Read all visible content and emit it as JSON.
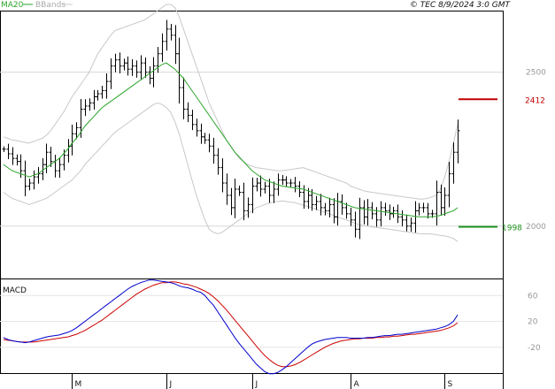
{
  "legend": {
    "ma_label": "MA20",
    "bands_label": "BBands"
  },
  "header": {
    "copyright": "© TEC 8/9/2024 3:0 GMT"
  },
  "macd": {
    "label": "MACD"
  },
  "colors": {
    "ma": "#2aa52a",
    "resistance": "#c00000",
    "support": "#1a8f1a",
    "macd": "#0000cc",
    "signal": "#cc0000",
    "bands": "#c8c8c8",
    "bars": "#000000"
  },
  "chart_data": {
    "type": "ohlc",
    "title": "",
    "resistance": {
      "value": 2412,
      "label": "2412"
    },
    "support": {
      "value": 1998,
      "label": "1998"
    },
    "price_axis": {
      "range": [
        1830,
        2700
      ],
      "ticks": [
        2500,
        2000
      ],
      "tick_labels": [
        "2500",
        "2000"
      ]
    },
    "macd_axis": {
      "range": [
        -60,
        85
      ],
      "ticks": [
        60,
        20,
        -20
      ],
      "tick_labels": [
        "60",
        "20",
        "-20"
      ]
    },
    "month_labels": [
      {
        "label": "M",
        "index": 16
      },
      {
        "label": "J",
        "index": 38
      },
      {
        "label": "J",
        "index": 58
      },
      {
        "label": "A",
        "index": 81
      },
      {
        "label": "S",
        "index": 103
      }
    ],
    "close": [
      2250,
      2235,
      2220,
      2210,
      2180,
      2130,
      2140,
      2160,
      2170,
      2200,
      2240,
      2210,
      2180,
      2200,
      2230,
      2260,
      2300,
      2320,
      2380,
      2390,
      2400,
      2420,
      2430,
      2440,
      2470,
      2520,
      2540,
      2520,
      2530,
      2510,
      2520,
      2500,
      2530,
      2500,
      2480,
      2520,
      2560,
      2600,
      2640,
      2620,
      2560,
      2450,
      2380,
      2360,
      2330,
      2310,
      2290,
      2280,
      2260,
      2230,
      2190,
      2140,
      2100,
      2060,
      2120,
      2110,
      2050,
      2070,
      2130,
      2140,
      2120,
      2130,
      2100,
      2120,
      2150,
      2150,
      2140,
      2140,
      2130,
      2110,
      2080,
      2100,
      2070,
      2080,
      2060,
      2050,
      2070,
      2030,
      2080,
      2060,
      2040,
      2020,
      1990,
      2060,
      2030,
      2060,
      2040,
      2020,
      2060,
      2050,
      2040,
      2050,
      2030,
      2020,
      2000,
      2010,
      2050,
      2060,
      2060,
      2040,
      2040,
      2110,
      2060,
      2100,
      2170,
      2240,
      2310
    ],
    "ma20": [
      2200,
      2190,
      2180,
      2175,
      2170,
      2165,
      2160,
      2165,
      2170,
      2180,
      2190,
      2200,
      2210,
      2220,
      2235,
      2250,
      2270,
      2285,
      2305,
      2325,
      2340,
      2355,
      2370,
      2385,
      2395,
      2405,
      2415,
      2425,
      2435,
      2445,
      2455,
      2465,
      2475,
      2485,
      2495,
      2505,
      2515,
      2525,
      2530,
      2520,
      2510,
      2495,
      2480,
      2460,
      2440,
      2420,
      2400,
      2380,
      2360,
      2340,
      2320,
      2300,
      2280,
      2260,
      2240,
      2225,
      2210,
      2195,
      2180,
      2170,
      2160,
      2150,
      2145,
      2140,
      2135,
      2130,
      2128,
      2126,
      2124,
      2122,
      2120,
      2115,
      2110,
      2105,
      2100,
      2095,
      2090,
      2085,
      2080,
      2075,
      2070,
      2065,
      2060,
      2058,
      2056,
      2054,
      2052,
      2050,
      2048,
      2046,
      2044,
      2042,
      2040,
      2038,
      2036,
      2034,
      2032,
      2030,
      2030,
      2030,
      2030,
      2032,
      2035,
      2040,
      2045,
      2050,
      2060
    ],
    "bb_upper": [
      2290,
      2285,
      2280,
      2278,
      2275,
      2272,
      2270,
      2275,
      2280,
      2285,
      2295,
      2310,
      2330,
      2350,
      2370,
      2395,
      2420,
      2440,
      2460,
      2480,
      2500,
      2530,
      2560,
      2580,
      2600,
      2620,
      2635,
      2640,
      2645,
      2650,
      2655,
      2660,
      2665,
      2670,
      2680,
      2690,
      2700,
      2710,
      2720,
      2720,
      2710,
      2680,
      2640,
      2600,
      2560,
      2520,
      2480,
      2440,
      2400,
      2370,
      2340,
      2310,
      2280,
      2260,
      2240,
      2220,
      2210,
      2200,
      2195,
      2190,
      2188,
      2186,
      2184,
      2182,
      2180,
      2180,
      2182,
      2184,
      2186,
      2188,
      2190,
      2185,
      2180,
      2175,
      2170,
      2165,
      2160,
      2155,
      2150,
      2145,
      2140,
      2130,
      2125,
      2120,
      2115,
      2112,
      2110,
      2108,
      2106,
      2104,
      2102,
      2100,
      2098,
      2096,
      2094,
      2092,
      2090,
      2088,
      2088,
      2090,
      2095,
      2100,
      2120,
      2160,
      2210,
      2270,
      2330
    ],
    "bb_lower": [
      2110,
      2100,
      2090,
      2085,
      2080,
      2075,
      2070,
      2075,
      2080,
      2085,
      2090,
      2100,
      2110,
      2120,
      2130,
      2140,
      2150,
      2165,
      2180,
      2200,
      2215,
      2230,
      2245,
      2260,
      2275,
      2290,
      2305,
      2315,
      2325,
      2335,
      2345,
      2355,
      2365,
      2375,
      2385,
      2395,
      2400,
      2395,
      2385,
      2370,
      2340,
      2300,
      2250,
      2200,
      2150,
      2100,
      2060,
      2020,
      1990,
      1980,
      1975,
      1980,
      1990,
      2000,
      2010,
      2020,
      2030,
      2040,
      2050,
      2060,
      2065,
      2070,
      2075,
      2078,
      2080,
      2082,
      2080,
      2078,
      2076,
      2072,
      2068,
      2064,
      2060,
      2055,
      2050,
      2045,
      2040,
      2035,
      2030,
      2025,
      2020,
      2015,
      2010,
      2005,
      2002,
      2000,
      1998,
      1996,
      1994,
      1992,
      1990,
      1988,
      1986,
      1984,
      1982,
      1980,
      1978,
      1976,
      1975,
      1975,
      1974,
      1972,
      1970,
      1968,
      1965,
      1960,
      1950
    ],
    "macd_line": [
      -5,
      -8,
      -10,
      -11,
      -12,
      -13,
      -12,
      -10,
      -8,
      -6,
      -4,
      -3,
      -2,
      -1,
      1,
      3,
      6,
      10,
      15,
      20,
      25,
      30,
      35,
      40,
      45,
      50,
      55,
      60,
      65,
      70,
      74,
      77,
      80,
      82,
      84,
      84,
      83,
      82,
      81,
      80,
      78,
      75,
      73,
      72,
      70,
      67,
      65,
      60,
      52,
      45,
      35,
      25,
      15,
      5,
      -5,
      -14,
      -22,
      -30,
      -38,
      -46,
      -52,
      -58,
      -61,
      -61,
      -59,
      -55,
      -50,
      -44,
      -38,
      -32,
      -26,
      -20,
      -15,
      -12,
      -10,
      -8,
      -7,
      -6,
      -5,
      -5,
      -5,
      -6,
      -6,
      -6,
      -6,
      -5,
      -5,
      -4,
      -3,
      -2,
      -2,
      -1,
      0,
      0,
      1,
      2,
      3,
      4,
      5,
      6,
      7,
      8,
      10,
      12,
      15,
      20,
      30
    ],
    "signal_line": [
      -8,
      -9,
      -10,
      -11,
      -12,
      -12,
      -12,
      -12,
      -11,
      -10,
      -9,
      -8,
      -7,
      -6,
      -5,
      -4,
      -2,
      0,
      3,
      6,
      10,
      14,
      18,
      22,
      27,
      32,
      37,
      42,
      47,
      52,
      57,
      62,
      66,
      70,
      73,
      76,
      78,
      80,
      80,
      81,
      81,
      80,
      78,
      77,
      75,
      73,
      70,
      67,
      63,
      58,
      52,
      45,
      38,
      30,
      22,
      14,
      6,
      -2,
      -10,
      -18,
      -26,
      -33,
      -39,
      -44,
      -48,
      -50,
      -50,
      -49,
      -47,
      -44,
      -40,
      -36,
      -32,
      -28,
      -24,
      -20,
      -17,
      -14,
      -12,
      -10,
      -9,
      -8,
      -7,
      -7,
      -6,
      -6,
      -6,
      -5,
      -5,
      -4,
      -4,
      -3,
      -3,
      -2,
      -1,
      0,
      0,
      1,
      2,
      3,
      4,
      5,
      6,
      8,
      10,
      13,
      18
    ]
  }
}
